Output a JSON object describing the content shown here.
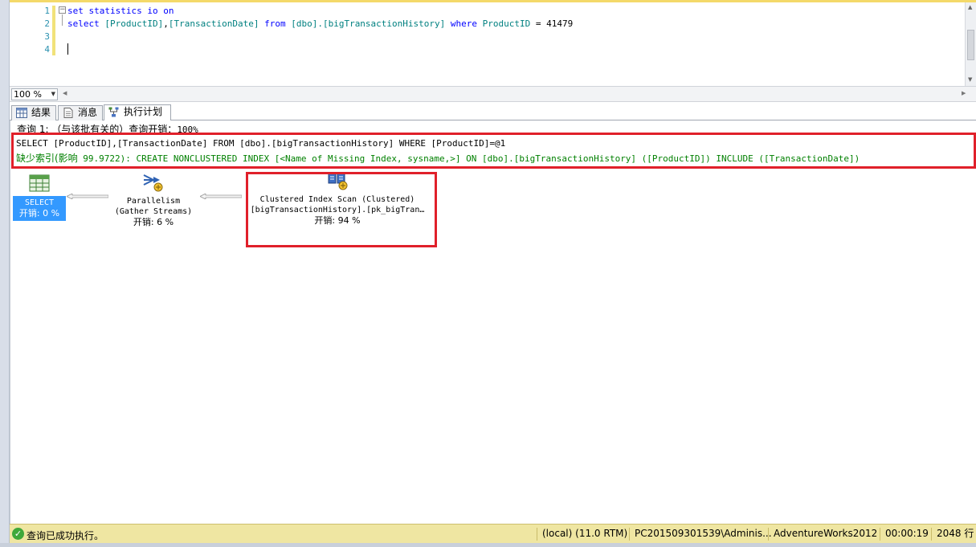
{
  "editor": {
    "line_numbers": [
      "1",
      "2",
      "3",
      "4"
    ],
    "line1": {
      "kw1": "set",
      "kw2": "statistics",
      "kw3": "io",
      "kw4": "on"
    },
    "line2": {
      "kw_select": "select",
      "col1": "[ProductID]",
      "comma": ",",
      "col2": "[TransactionDate]",
      "kw_from": "from",
      "schema": "[dbo].",
      "table": "[bigTransactionHistory]",
      "kw_where": "where",
      "col3": "ProductID",
      "op": "=",
      "value": "41479"
    }
  },
  "zoom": {
    "value": "100 %"
  },
  "tabs": {
    "results": "结果",
    "messages": "消息",
    "plan": "执行计划"
  },
  "plan": {
    "query_header": "查询 1: （与该批有关的）查询开销：",
    "query_header_pct": "100%",
    "sql_text": "SELECT [ProductID],[TransactionDate] FROM [dbo].[bigTransactionHistory] WHERE [ProductID]=@1",
    "missing_index_prefix": "缺少索引(影响",
    "missing_index_text": " 99.9722): CREATE NONCLUSTERED INDEX [<Name of Missing Index, sysname,>] ON [dbo].[bigTransactionHistory] ([ProductID]) INCLUDE ([TransactionDate])",
    "nodes": {
      "select": {
        "label": "SELECT",
        "cost": "开销: 0 %"
      },
      "parallelism": {
        "label": "Parallelism",
        "sub": "(Gather Streams)",
        "cost": "开销: 6 %"
      },
      "scan": {
        "label": "Clustered Index Scan (Clustered)",
        "sub": "[bigTransactionHistory].[pk_bigTran…",
        "cost": "开销: 94 %"
      }
    }
  },
  "status": {
    "message": "查询已成功执行。",
    "server": "(local) (11.0 RTM)",
    "user": "PC201509301539\\Adminis...",
    "database": "AdventureWorks2012",
    "elapsed": "00:00:19",
    "rows": "2048 行"
  },
  "colors": {
    "highlight_red": "#e0202a",
    "status_yellow": "#efe6a2",
    "select_blue": "#3399ff",
    "keyword_blue": "#0000ff",
    "identifier_teal": "#008080",
    "missing_index_green": "#008000"
  }
}
